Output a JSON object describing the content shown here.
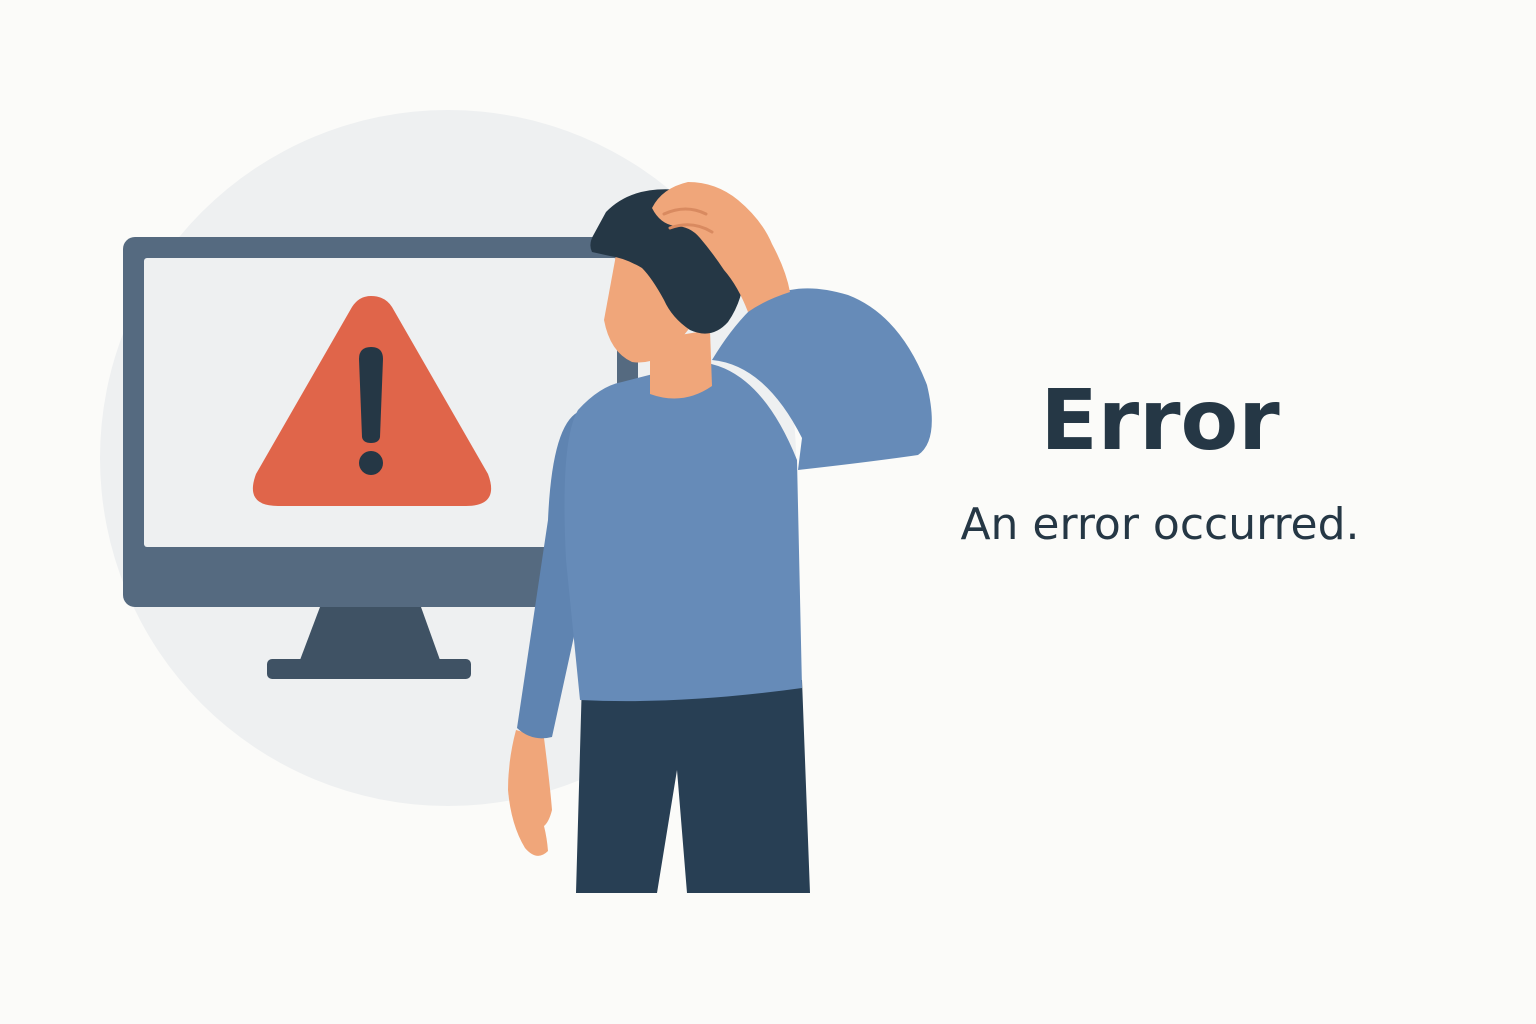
{
  "error_page": {
    "title": "Error",
    "message": "An error occurred."
  },
  "illustration": {
    "icons": [
      "computer-monitor-icon",
      "warning-triangle-icon",
      "confused-person-figure"
    ]
  },
  "colors": {
    "background": "#fbfbf9",
    "text": "#253745",
    "warning": "#e0654a",
    "monitor": "#556a80",
    "screen": "#eef0f1",
    "shirt": "#668bb8",
    "pants": "#283f54",
    "skin": "#f0a67a",
    "hair": "#253745"
  }
}
